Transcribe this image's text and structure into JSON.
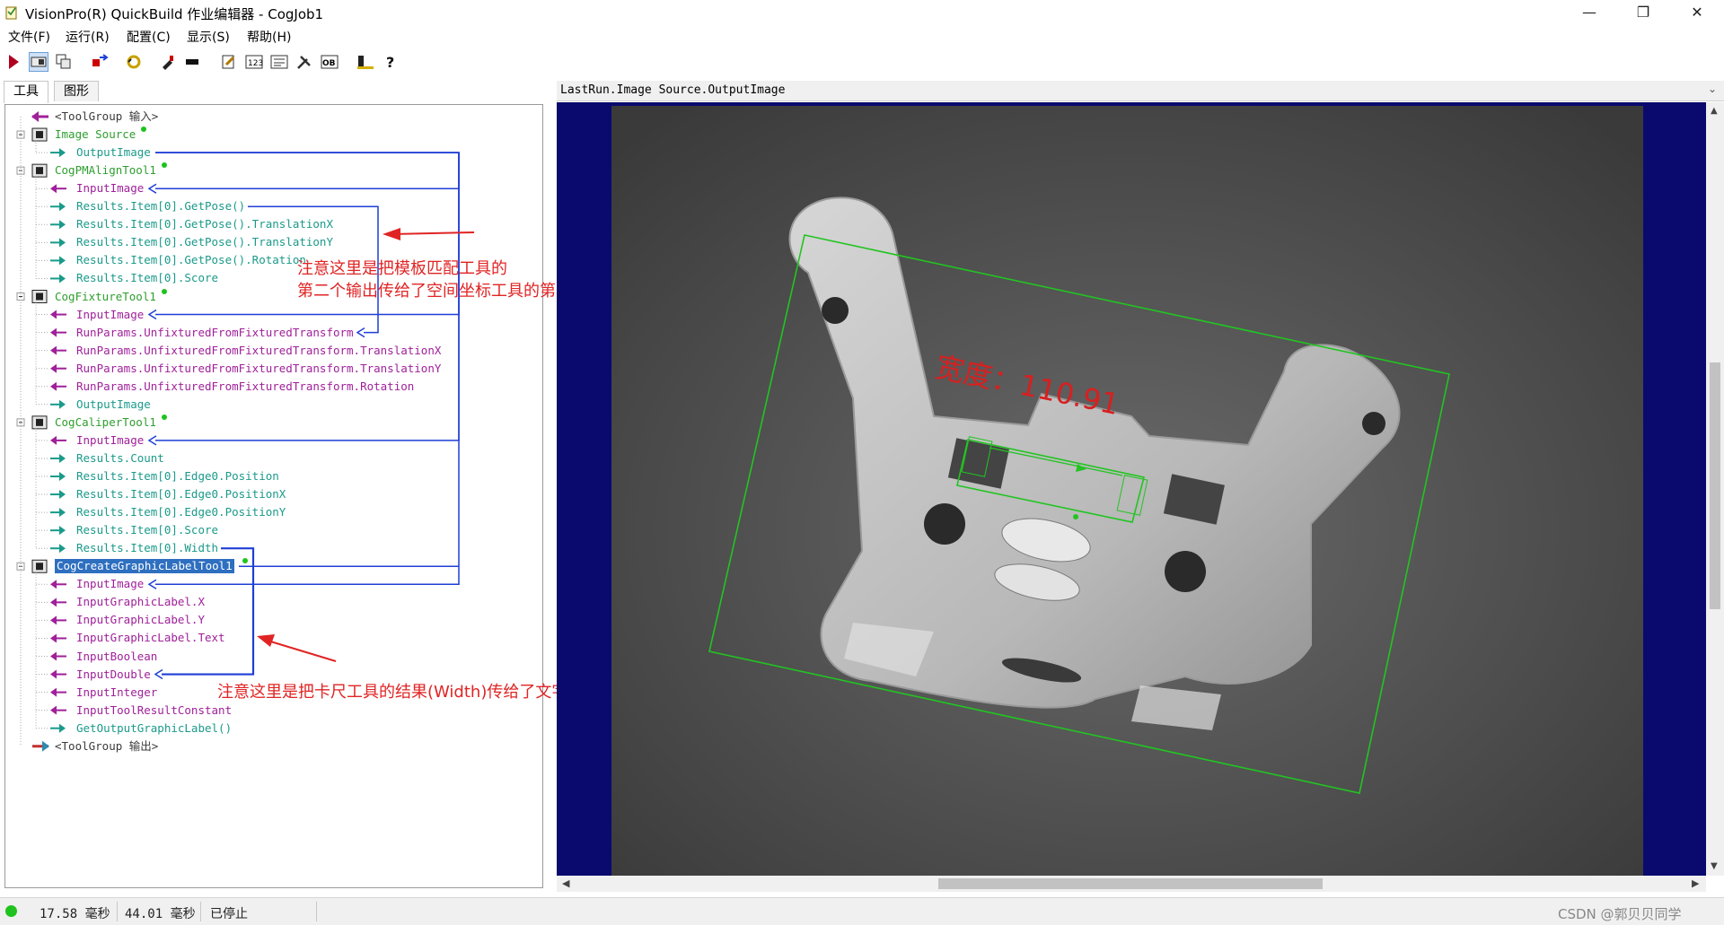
{
  "window": {
    "title": "VisionPro(R) QuickBuild 作业编辑器 - CogJob1",
    "minimize": "—",
    "maximize": "❐",
    "close": "✕"
  },
  "menu": [
    "文件(F)",
    "运行(R)",
    "配置(C)",
    "显示(S)",
    "帮助(H)"
  ],
  "toolbar": {
    "items": [
      "run-icon",
      "camera-view-icon",
      "image-copy-icon",
      "tool-swap-icon",
      "refresh-icon",
      "brush-icon",
      "chip-icon",
      "edit-icon",
      "numeric-icon",
      "result-icon",
      "tools-icon",
      "ocr-icon",
      "terminal-icon",
      "help-icon"
    ]
  },
  "left_tabs": [
    "工具",
    "图形"
  ],
  "tree": [
    {
      "text": "<ToolGroup 输入>",
      "kind": "top"
    },
    {
      "text": "Image Source",
      "kind": "tool"
    },
    {
      "text": "OutputImage",
      "kind": "out"
    },
    {
      "text": "CogPMAlignTool1",
      "kind": "tool"
    },
    {
      "text": "InputImage",
      "kind": "in"
    },
    {
      "text": "Results.Item[0].GetPose()",
      "kind": "out"
    },
    {
      "text": "Results.Item[0].GetPose().TranslationX",
      "kind": "out"
    },
    {
      "text": "Results.Item[0].GetPose().TranslationY",
      "kind": "out"
    },
    {
      "text": "Results.Item[0].GetPose().Rotation",
      "kind": "out"
    },
    {
      "text": "Results.Item[0].Score",
      "kind": "out"
    },
    {
      "text": "CogFixtureTool1",
      "kind": "tool"
    },
    {
      "text": "InputImage",
      "kind": "in"
    },
    {
      "text": "RunParams.UnfixturedFromFixturedTransform",
      "kind": "in"
    },
    {
      "text": "RunParams.UnfixturedFromFixturedTransform.TranslationX",
      "kind": "in"
    },
    {
      "text": "RunParams.UnfixturedFromFixturedTransform.TranslationY",
      "kind": "in"
    },
    {
      "text": "RunParams.UnfixturedFromFixturedTransform.Rotation",
      "kind": "in"
    },
    {
      "text": "OutputImage",
      "kind": "out"
    },
    {
      "text": "CogCaliperTool1",
      "kind": "tool"
    },
    {
      "text": "InputImage",
      "kind": "in"
    },
    {
      "text": "Results.Count",
      "kind": "out"
    },
    {
      "text": "Results.Item[0].Edge0.Position",
      "kind": "out"
    },
    {
      "text": "Results.Item[0].Edge0.PositionX",
      "kind": "out"
    },
    {
      "text": "Results.Item[0].Edge0.PositionY",
      "kind": "out"
    },
    {
      "text": "Results.Item[0].Score",
      "kind": "out"
    },
    {
      "text": "Results.Item[0].Width",
      "kind": "out"
    },
    {
      "text": "CogCreateGraphicLabelTool1",
      "kind": "tool",
      "selected": true
    },
    {
      "text": "InputImage",
      "kind": "in"
    },
    {
      "text": "InputGraphicLabel.X",
      "kind": "in"
    },
    {
      "text": "InputGraphicLabel.Y",
      "kind": "in"
    },
    {
      "text": "InputGraphicLabel.Text",
      "kind": "in"
    },
    {
      "text": "InputBoolean",
      "kind": "in"
    },
    {
      "text": "InputDouble",
      "kind": "in"
    },
    {
      "text": "InputInteger",
      "kind": "in"
    },
    {
      "text": "InputToolResultConstant",
      "kind": "in"
    },
    {
      "text": "GetOutputGraphicLabel()",
      "kind": "out"
    },
    {
      "text": "<ToolGroup 输出>",
      "kind": "top"
    }
  ],
  "annotations": {
    "note1_line1": "注意这里是把模板匹配工具的",
    "note1_line2": "第二个输出传给了空间坐标工具的第二个输入上面",
    "note2": "注意这里是把卡尺工具的结果(Width)传给了文字工具"
  },
  "display": {
    "header": "LastRun.Image Source.OutputImage",
    "label_text": "宽度：110.91"
  },
  "status": {
    "time1": "17.58 毫秒",
    "time2": "44.01 毫秒",
    "state": "已停止",
    "watermark": "CSDN @郭贝贝同学"
  },
  "colors": {
    "tool_green": "#2e9e2e",
    "output_teal": "#1a9a8a",
    "input_purple": "#a0209a",
    "link_blue": "#1f3fd6",
    "note_red": "#e02424",
    "image_bg": "#0a0a6e"
  }
}
